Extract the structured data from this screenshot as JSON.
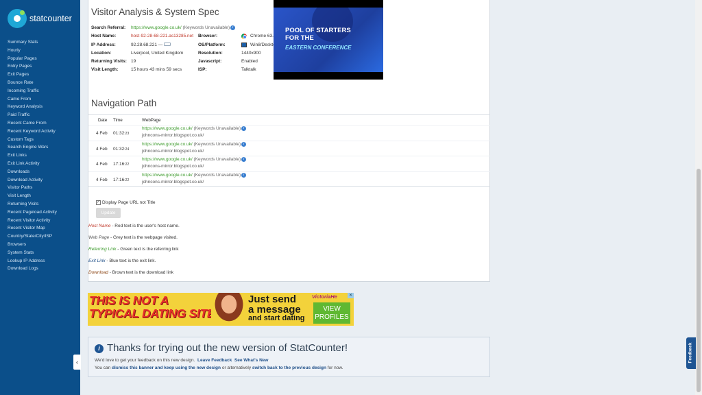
{
  "brand": {
    "name": "statcounter"
  },
  "sidebar": {
    "items": [
      "Summary Stats",
      "Hourly",
      "Popular Pages",
      "Entry Pages",
      "Exit Pages",
      "Bounce Rate",
      "Incoming Traffic",
      "Came From",
      "Keyword Analysis",
      "Paid Traffic",
      "Recent Came From",
      "Recent Keyword Activity",
      "Custom Tags",
      "Search Engine Wars",
      "Exit Links",
      "Exit Link Activity",
      "Downloads",
      "Download Activity",
      "Visitor Paths",
      "Visit Length",
      "Returning Visits",
      "Recent Pageload Activity",
      "Recent Visitor Activity",
      "Recent Visitor Map",
      "Country/State/City/ISP",
      "Browsers",
      "System Stats",
      "Lookup IP Address",
      "Download Logs"
    ],
    "collapse_glyph": "‹"
  },
  "spec": {
    "title": "Visitor Analysis & System Spec",
    "search_referral_label": "Search Referral:",
    "search_referral_url": "https://www.google.co.uk/",
    "search_referral_note": "(Keywords Unavailable)",
    "rows": [
      {
        "l1": "Host Name:",
        "v1": "host-92-28-68-221.as13285.net",
        "l2": "Browser:",
        "v2": "Chrome 63.0"
      },
      {
        "l1": "IP Address:",
        "v1": "92.28.68.221 —",
        "l2": "OS/Platform:",
        "v2": "Win8/Desktop"
      },
      {
        "l1": "Location:",
        "v1": "Liverpool, United Kingdom",
        "l2": "Resolution:",
        "v2": "1440x900"
      },
      {
        "l1": "Returning Visits:",
        "v1": "19",
        "l2": "Javascript:",
        "v2": "Enabled"
      },
      {
        "l1": "Visit Length:",
        "v1": "15 hours 43 mins 59 secs",
        "l2": "ISP:",
        "v2": "Talktalk"
      }
    ]
  },
  "ad_top": {
    "line1": "POOL OF STARTERS",
    "line2": "FOR THE",
    "line3": "EASTERN CONFERENCE"
  },
  "navpath": {
    "title": "Navigation Path",
    "headers": [
      "Date",
      "Time",
      "WebPage"
    ],
    "rows": [
      {
        "date": "4 Feb",
        "time": "01:32",
        "sec": ":23",
        "url": "https://www.google.co.uk/",
        "note": "(Keywords Unavailable)",
        "page": "johncons-mirror.blogspot.co.uk/"
      },
      {
        "date": "4 Feb",
        "time": "01:32",
        "sec": ":24",
        "url": "https://www.google.co.uk/",
        "note": "(Keywords Unavailable)",
        "page": "johncons-mirror.blogspot.co.uk/"
      },
      {
        "date": "4 Feb",
        "time": "17:16",
        "sec": ":22",
        "url": "https://www.google.co.uk/",
        "note": "(Keywords Unavailable)",
        "page": "johncons-mirror.blogspot.co.uk/"
      },
      {
        "date": "4 Feb",
        "time": "17:16",
        "sec": ":22",
        "url": "https://www.google.co.uk/",
        "note": "(Keywords Unavailable)",
        "page": "johncons-mirror.blogspot.co.uk/"
      }
    ],
    "checkbox_label": "Display Page URL not Title",
    "update_label": "Update"
  },
  "legend": [
    {
      "term": "Host Name",
      "desc": " - Red text is the user's host name.",
      "color": "#c0392b"
    },
    {
      "term": "Web Page",
      "desc": " - Grey text is the webpage visited.",
      "color": "#555555"
    },
    {
      "term": "Referring Link",
      "desc": " - Green text is the referring link",
      "color": "#3b9a2b"
    },
    {
      "term": "Exit Link",
      "desc": " - Blue text is the exit link.",
      "color": "#1f4f88"
    },
    {
      "term": "Download",
      "desc": " - Brown text is the download link",
      "color": "#8b4513"
    }
  ],
  "ad_dating": {
    "line1": "THIS IS NOT A",
    "line2": "TYPICAL DATING SITE",
    "just_send": "Just send",
    "a_message": "a message",
    "start": "and start dating",
    "brand": "VictoriaHe",
    "cta1": "VIEW",
    "cta2": "PROFILES"
  },
  "thanks": {
    "title": "Thanks for trying out the new version of StatCounter!",
    "line1_text": "We'd love to get your feedback on this new design.",
    "leave_feedback": "Leave Feedback",
    "whats_new": "See What's New",
    "line2_a": "You can",
    "dismiss": "dismiss this banner and keep using the new design",
    "line2_b": "or alternatively",
    "switch": "switch back to the previous design",
    "line2_c": "for now."
  },
  "feedback_tab": "Feedback"
}
